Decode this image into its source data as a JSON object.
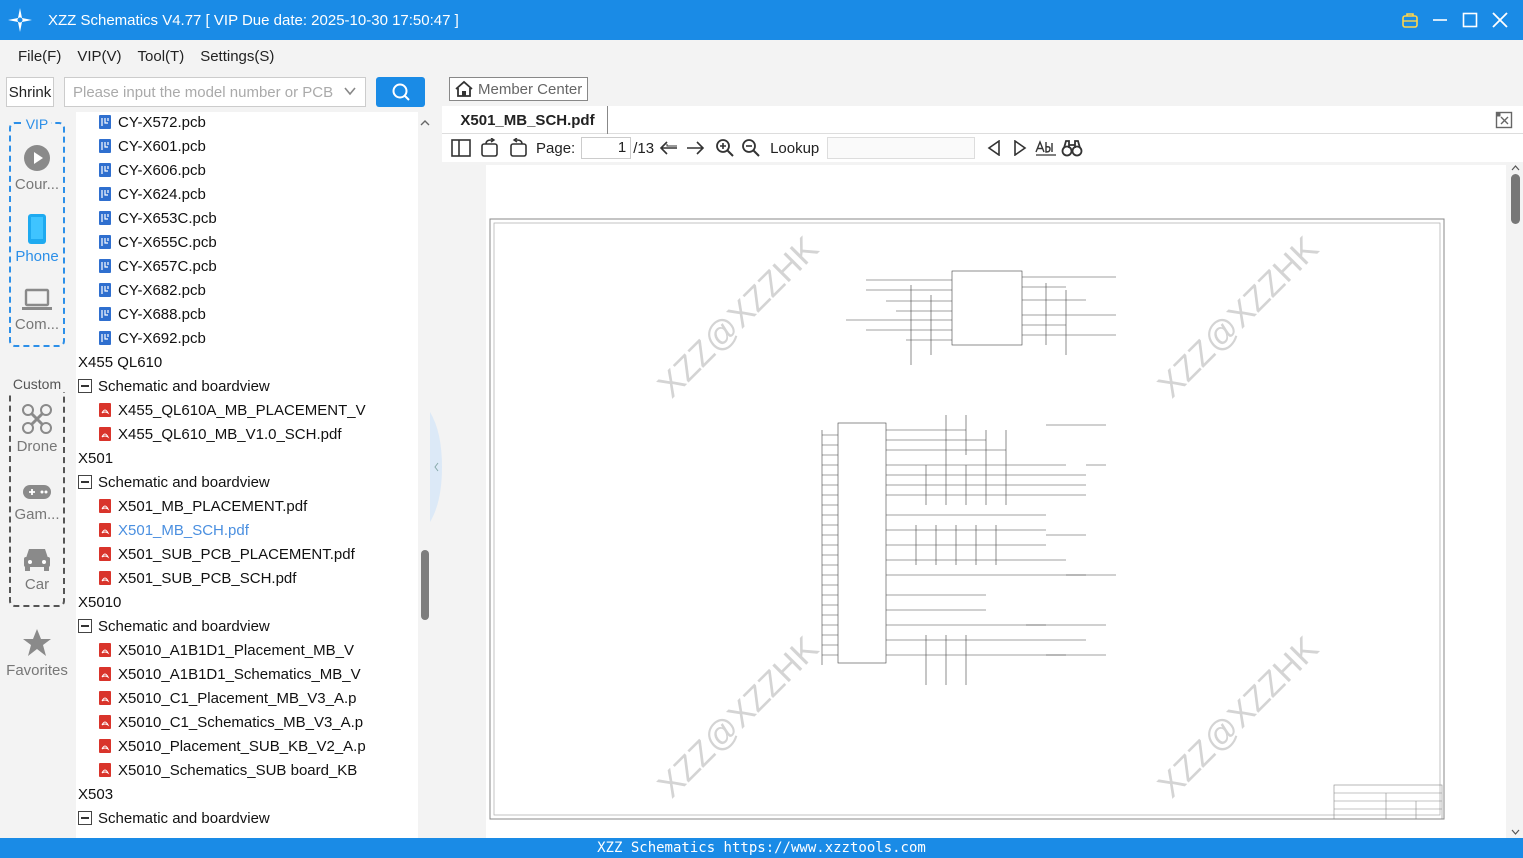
{
  "window": {
    "title": "XZZ Schematics V4.77 [ VIP Due date: 2025-10-30 17:50:47 ]"
  },
  "menu": [
    "File(F)",
    "VIP(V)",
    "Tool(T)",
    "Settings(S)"
  ],
  "search": {
    "shrink_label": "Shrink",
    "placeholder": "Please input the model number or PCB"
  },
  "categories": {
    "vip_label": "VIP",
    "custom_label": "Custom",
    "items": [
      "Cour...",
      "Phone",
      "Com...",
      "Drone",
      "Gam...",
      "Car",
      "Favorites"
    ]
  },
  "tree": [
    {
      "label": "CY-X572.pcb",
      "kind": "pcb",
      "level": 3
    },
    {
      "label": "CY-X601.pcb",
      "kind": "pcb",
      "level": 3
    },
    {
      "label": "CY-X606.pcb",
      "kind": "pcb",
      "level": 3
    },
    {
      "label": "CY-X624.pcb",
      "kind": "pcb",
      "level": 3
    },
    {
      "label": "CY-X653C.pcb",
      "kind": "pcb",
      "level": 3
    },
    {
      "label": "CY-X655C.pcb",
      "kind": "pcb",
      "level": 3
    },
    {
      "label": "CY-X657C.pcb",
      "kind": "pcb",
      "level": 3
    },
    {
      "label": "CY-X682.pcb",
      "kind": "pcb",
      "level": 3
    },
    {
      "label": "CY-X688.pcb",
      "kind": "pcb",
      "level": 3
    },
    {
      "label": "CY-X692.pcb",
      "kind": "pcb",
      "level": 3
    },
    {
      "label": "X455 QL610",
      "kind": "folder",
      "level": 1
    },
    {
      "label": "Schematic and boardview",
      "kind": "folder",
      "level": 2
    },
    {
      "label": "X455_QL610A_MB_PLACEMENT_V",
      "kind": "pdf",
      "level": 3
    },
    {
      "label": "X455_QL610_MB_V1.0_SCH.pdf",
      "kind": "pdf",
      "level": 3
    },
    {
      "label": "X501",
      "kind": "folder",
      "level": 1
    },
    {
      "label": "Schematic and boardview",
      "kind": "folder",
      "level": 2
    },
    {
      "label": "X501_MB_PLACEMENT.pdf",
      "kind": "pdf",
      "level": 3
    },
    {
      "label": "X501_MB_SCH.pdf",
      "kind": "pdf",
      "level": 3,
      "selected": true
    },
    {
      "label": "X501_SUB_PCB_PLACEMENT.pdf",
      "kind": "pdf",
      "level": 3
    },
    {
      "label": "X501_SUB_PCB_SCH.pdf",
      "kind": "pdf",
      "level": 3
    },
    {
      "label": "X5010",
      "kind": "folder",
      "level": 1
    },
    {
      "label": "Schematic and boardview",
      "kind": "folder",
      "level": 2
    },
    {
      "label": "X5010_A1B1D1_Placement_MB_V",
      "kind": "pdf",
      "level": 3
    },
    {
      "label": "X5010_A1B1D1_Schematics_MB_V",
      "kind": "pdf",
      "level": 3
    },
    {
      "label": "X5010_C1_Placement_MB_V3_A.p",
      "kind": "pdf",
      "level": 3
    },
    {
      "label": "X5010_C1_Schematics_MB_V3_A.p",
      "kind": "pdf",
      "level": 3
    },
    {
      "label": "X5010_Placement_SUB_KB_V2_A.p",
      "kind": "pdf",
      "level": 3
    },
    {
      "label": "X5010_Schematics_SUB board_KB",
      "kind": "pdf",
      "level": 3
    },
    {
      "label": "X503",
      "kind": "folder",
      "level": 1
    },
    {
      "label": "Schematic and boardview",
      "kind": "folder",
      "level": 2
    }
  ],
  "viewer": {
    "member_center": "Member Center",
    "tab_title": "X501_MB_SCH.pdf",
    "page_label": "Page:",
    "page_current": "1",
    "page_total": "/13",
    "lookup_label": "Lookup",
    "watermark": "XZZ@XZZHK"
  },
  "statusbar": "XZZ Schematics https://www.xzztools.com",
  "colors": {
    "accent": "#1a8be6",
    "selected": "#4a8fe0",
    "pdf": "#d9342b",
    "pcb": "#2f6fcf"
  }
}
